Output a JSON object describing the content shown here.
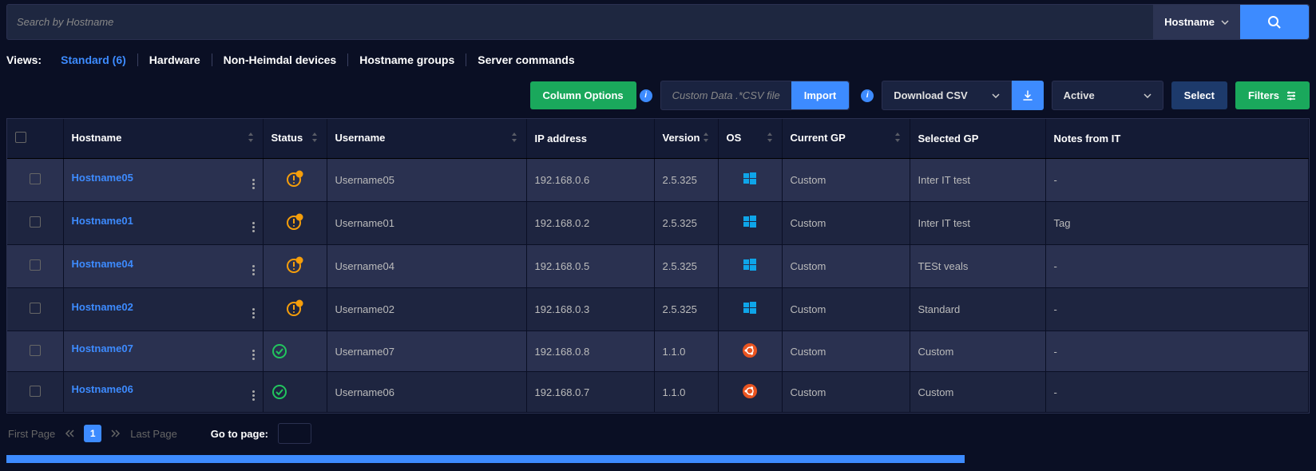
{
  "search": {
    "placeholder": "Search by Hostname",
    "type_label": "Hostname"
  },
  "views": {
    "label": "Views:",
    "tabs": [
      {
        "label": "Standard (6)",
        "active": true
      },
      {
        "label": "Hardware"
      },
      {
        "label": "Non-Heimdal devices"
      },
      {
        "label": "Hostname groups"
      },
      {
        "label": "Server commands"
      }
    ]
  },
  "toolbar": {
    "column_options": "Column Options",
    "custom_data_placeholder": "Custom Data .*CSV file",
    "import": "Import",
    "download_csv": "Download CSV",
    "status_filter": "Active",
    "select": "Select",
    "filters": "Filters"
  },
  "columns": {
    "hostname": "Hostname",
    "status": "Status",
    "username": "Username",
    "ip": "IP address",
    "version": "Version",
    "os": "OS",
    "current_gp": "Current GP",
    "selected_gp": "Selected GP",
    "notes": "Notes from IT"
  },
  "rows": [
    {
      "hostname": "Hostname05",
      "status": "warn",
      "username": "Username05",
      "ip": "192.168.0.6",
      "version": "2.5.325",
      "os": "windows",
      "current_gp": "Custom",
      "selected_gp": "Inter IT test",
      "notes": "-"
    },
    {
      "hostname": "Hostname01",
      "status": "warn",
      "username": "Username01",
      "ip": "192.168.0.2",
      "version": "2.5.325",
      "os": "windows",
      "current_gp": "Custom",
      "selected_gp": "Inter IT test",
      "notes": "Tag"
    },
    {
      "hostname": "Hostname04",
      "status": "warn",
      "username": "Username04",
      "ip": "192.168.0.5",
      "version": "2.5.325",
      "os": "windows",
      "current_gp": "Custom",
      "selected_gp": "TESt veals",
      "notes": "-"
    },
    {
      "hostname": "Hostname02",
      "status": "warn",
      "username": "Username02",
      "ip": "192.168.0.3",
      "version": "2.5.325",
      "os": "windows",
      "current_gp": "Custom",
      "selected_gp": "Standard",
      "notes": "-"
    },
    {
      "hostname": "Hostname07",
      "status": "ok",
      "username": "Username07",
      "ip": "192.168.0.8",
      "version": "1.1.0",
      "os": "ubuntu",
      "current_gp": "Custom",
      "selected_gp": "Custom",
      "notes": "-"
    },
    {
      "hostname": "Hostname06",
      "status": "ok",
      "username": "Username06",
      "ip": "192.168.0.7",
      "version": "1.1.0",
      "os": "ubuntu",
      "current_gp": "Custom",
      "selected_gp": "Custom",
      "notes": "-"
    }
  ],
  "pagination": {
    "first": "First Page",
    "last": "Last Page",
    "current": "1",
    "goto": "Go to page:"
  }
}
